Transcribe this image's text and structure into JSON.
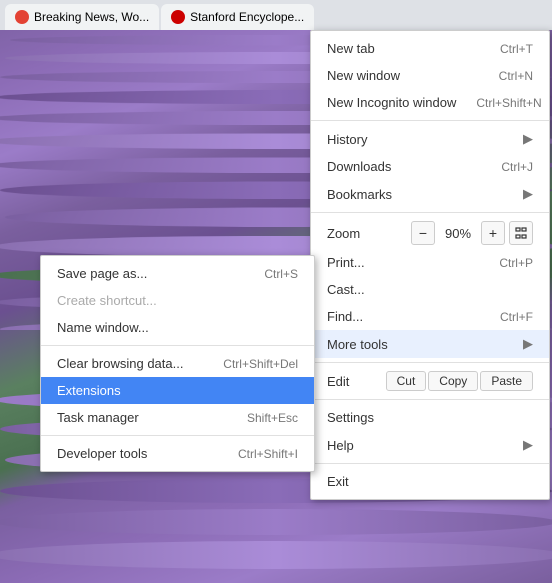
{
  "background": {
    "description": "Lavender field"
  },
  "tabs": [
    {
      "id": "tab1",
      "label": "Breaking News, Wo...",
      "icon_color": "#e34234"
    },
    {
      "id": "tab2",
      "label": "Stanford Encyclope...",
      "icon_color": "#cc0000"
    }
  ],
  "menu_left": {
    "items": [
      {
        "id": "save-page-as",
        "label": "Save page as...",
        "shortcut": "Ctrl+S",
        "arrow": false,
        "disabled": false
      },
      {
        "id": "create-shortcut",
        "label": "Create shortcut...",
        "shortcut": "",
        "arrow": false,
        "disabled": true
      },
      {
        "id": "name-window",
        "label": "Name window...",
        "shortcut": "",
        "arrow": false,
        "disabled": false
      },
      {
        "divider": true
      },
      {
        "id": "clear-browsing-data",
        "label": "Clear browsing data...",
        "shortcut": "Ctrl+Shift+Del",
        "arrow": false,
        "disabled": false
      },
      {
        "id": "extensions",
        "label": "Extensions",
        "shortcut": "",
        "arrow": false,
        "disabled": false,
        "highlighted": true
      },
      {
        "id": "task-manager",
        "label": "Task manager",
        "shortcut": "Shift+Esc",
        "arrow": false,
        "disabled": false
      },
      {
        "divider": true
      },
      {
        "id": "developer-tools",
        "label": "Developer tools",
        "shortcut": "Ctrl+Shift+I",
        "arrow": false,
        "disabled": false
      }
    ]
  },
  "menu_right": {
    "items": [
      {
        "id": "new-tab",
        "label": "New tab",
        "shortcut": "Ctrl+T",
        "arrow": false
      },
      {
        "id": "new-window",
        "label": "New window",
        "shortcut": "Ctrl+N",
        "arrow": false
      },
      {
        "id": "new-incognito",
        "label": "New Incognito window",
        "shortcut": "Ctrl+Shift+N",
        "arrow": false
      },
      {
        "divider": true
      },
      {
        "id": "history",
        "label": "History",
        "shortcut": "",
        "arrow": true
      },
      {
        "id": "downloads",
        "label": "Downloads",
        "shortcut": "Ctrl+J",
        "arrow": false
      },
      {
        "id": "bookmarks",
        "label": "Bookmarks",
        "shortcut": "",
        "arrow": true
      },
      {
        "divider": true
      },
      {
        "id": "zoom",
        "label": "Zoom",
        "value": "90%",
        "type": "zoom"
      },
      {
        "id": "print",
        "label": "Print...",
        "shortcut": "Ctrl+P",
        "arrow": false
      },
      {
        "id": "cast",
        "label": "Cast...",
        "shortcut": "",
        "arrow": false
      },
      {
        "id": "find",
        "label": "Find...",
        "shortcut": "Ctrl+F",
        "arrow": false
      },
      {
        "id": "more-tools",
        "label": "More tools",
        "shortcut": "",
        "arrow": true,
        "active": true
      },
      {
        "divider": true
      },
      {
        "id": "edit",
        "label": "Edit",
        "type": "edit",
        "cut": "Cut",
        "copy": "Copy",
        "paste": "Paste"
      },
      {
        "divider": true
      },
      {
        "id": "settings",
        "label": "Settings",
        "shortcut": "",
        "arrow": false
      },
      {
        "id": "help",
        "label": "Help",
        "shortcut": "",
        "arrow": true
      },
      {
        "divider": true
      },
      {
        "id": "exit",
        "label": "Exit",
        "shortcut": "",
        "arrow": false
      }
    ],
    "zoom_value": "90%",
    "zoom_minus": "−",
    "zoom_plus": "+",
    "cut_label": "Cut",
    "copy_label": "Copy",
    "paste_label": "Paste"
  }
}
